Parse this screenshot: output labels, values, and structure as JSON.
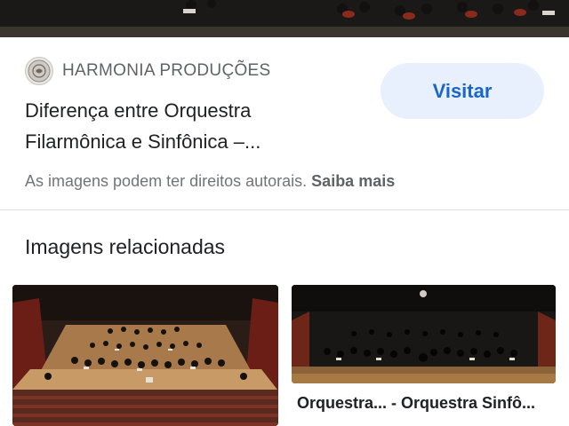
{
  "source": {
    "name": "HARMONIA PRODUÇÕES",
    "icon": "harmonia-logo-icon"
  },
  "visit_button": {
    "label": "Visitar"
  },
  "result": {
    "title_line1": "Diferença entre Orquestra",
    "title_line2": "Filarmônica e Sinfônica –..."
  },
  "copyright": {
    "text": "As imagens podem ter direitos autorais.",
    "learn_more": "Saiba mais"
  },
  "related": {
    "heading": "Imagens relacionadas",
    "items": [
      {
        "caption": ""
      },
      {
        "caption": "Orquestra... - Orquestra Sinfô..."
      }
    ]
  },
  "colors": {
    "accent": "#1a66c8",
    "button_bg": "#e8f0fe",
    "muted_text": "#70757a"
  }
}
